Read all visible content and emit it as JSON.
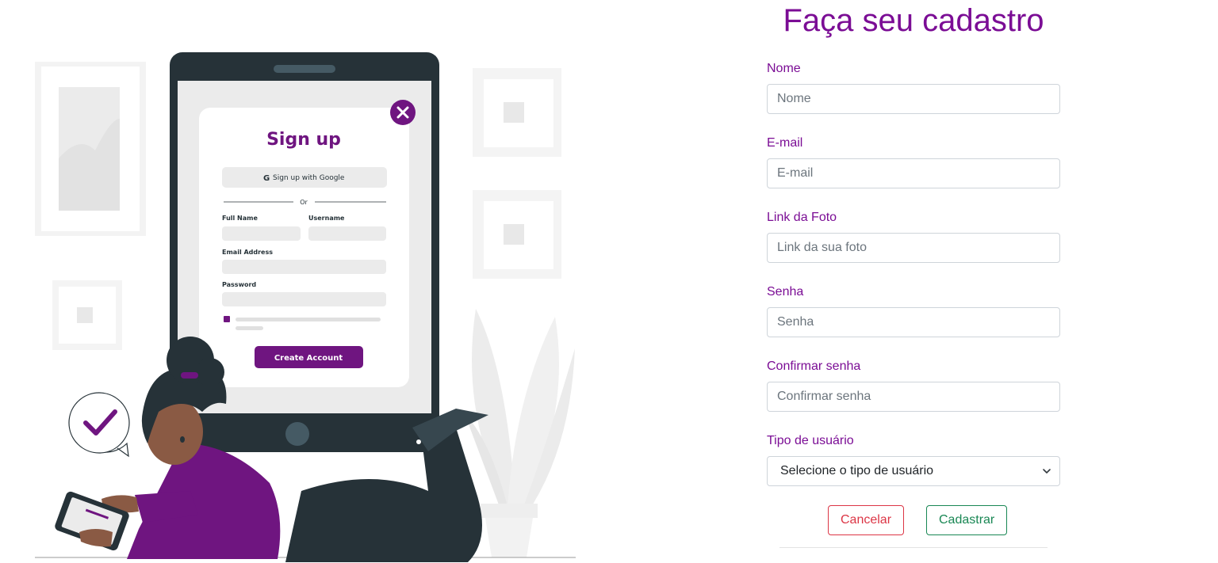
{
  "illustration": {
    "card_title": "Sign up",
    "google_button": "Sign up with Google",
    "separator": "Or",
    "full_name_label": "Full Name",
    "username_label": "Username",
    "email_label": "Email Address",
    "password_label": "Password",
    "create_button": "Create Account",
    "accent_color": "#6f1580"
  },
  "form": {
    "title": "Faça seu cadastro",
    "fields": [
      {
        "label": "Nome",
        "placeholder": "Nome"
      },
      {
        "label": "E-mail",
        "placeholder": "E-mail"
      },
      {
        "label": "Link da Foto",
        "placeholder": "Link da sua foto"
      },
      {
        "label": "Senha",
        "placeholder": "Senha"
      },
      {
        "label": "Confirmar senha",
        "placeholder": "Confirmar senha"
      }
    ],
    "user_type": {
      "label": "Tipo de usuário",
      "selected": "Selecione o tipo de usuário"
    },
    "cancel_label": "Cancelar",
    "submit_label": "Cadastrar",
    "colors": {
      "accent": "#7b0d95",
      "cancel": "#dc3545",
      "submit": "#198754"
    }
  }
}
